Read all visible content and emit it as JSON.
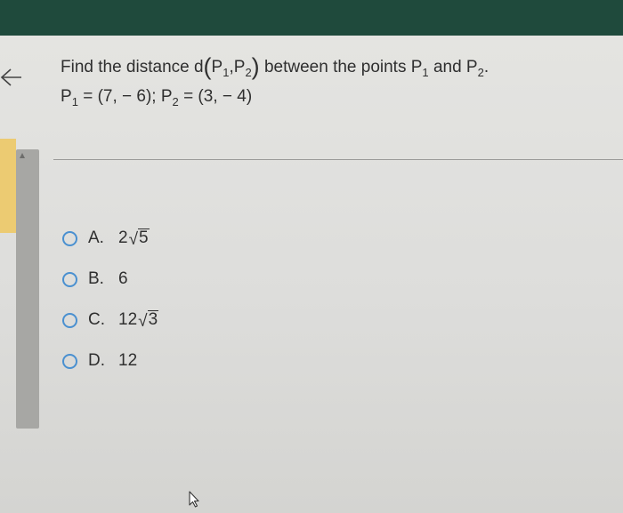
{
  "question": {
    "prompt_before": "Find the distance d",
    "paren_open": "(",
    "p1_letter": "P",
    "p1_sub": "1",
    "comma": ",",
    "p2_letter": "P",
    "p2_sub": "2",
    "paren_close": ")",
    "prompt_middle": "between the points P",
    "middle_sub": "1",
    "prompt_and": "and P",
    "and_sub": "2",
    "prompt_end": ".",
    "given_p1_letter": "P",
    "given_p1_sub": "1",
    "given_p1_value": "= (7, − 6);",
    "given_p2_letter": "P",
    "given_p2_sub": "2",
    "given_p2_value": "= (3, − 4)"
  },
  "options": [
    {
      "letter": "A.",
      "coef": "2",
      "radical": "√",
      "radicand": "5",
      "value": ""
    },
    {
      "letter": "B.",
      "coef": "",
      "radical": "",
      "radicand": "",
      "value": "6"
    },
    {
      "letter": "C.",
      "coef": "12",
      "radical": "√",
      "radicand": "3",
      "value": ""
    },
    {
      "letter": "D.",
      "coef": "",
      "radical": "",
      "radicand": "",
      "value": "12"
    }
  ],
  "colors": {
    "top_bar": "#1f4a3c",
    "radio_border": "#4a90d0",
    "scroll_highlight": "#eccb72",
    "text": "#2f2f2f"
  },
  "icons": {
    "back": "back-arrow-icon",
    "cursor": "mouse-pointer-icon",
    "scroll": "scroll-up-icon"
  }
}
